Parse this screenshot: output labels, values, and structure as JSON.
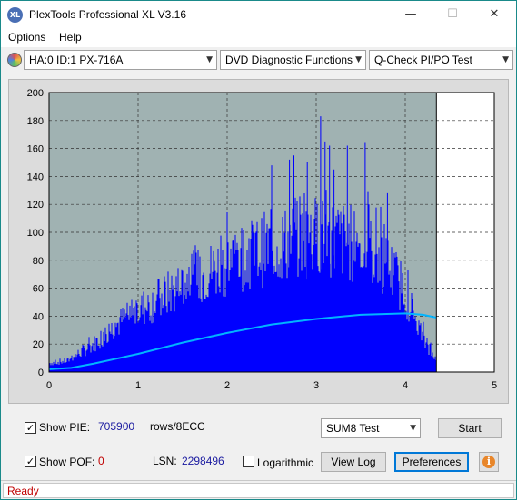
{
  "window": {
    "title": "PlexTools Professional XL V3.16",
    "logo_text": "XL",
    "minimize": "—",
    "maximize": "☐",
    "close": "✕"
  },
  "menu": {
    "options": "Options",
    "help": "Help"
  },
  "toolbar": {
    "drive": "HA:0 ID:1  PX-716A",
    "function": "DVD Diagnostic Functions",
    "test": "Q-Check PI/PO Test",
    "dropdown_arrow": "▼"
  },
  "chart_data": {
    "type": "bar",
    "x_ticks": [
      "0",
      "1",
      "2",
      "3",
      "4",
      "5"
    ],
    "y_ticks": [
      "0",
      "20",
      "40",
      "60",
      "80",
      "100",
      "120",
      "140",
      "160",
      "180",
      "200"
    ],
    "xlim": [
      0,
      5
    ],
    "ylim": [
      0,
      200
    ],
    "grid": true,
    "data_end_x": 4.35,
    "pie_envelope": {
      "x": [
        0,
        0.2,
        0.5,
        0.8,
        1.0,
        1.3,
        1.6,
        1.9,
        2.2,
        2.5,
        2.8,
        3.0,
        3.2,
        3.4,
        3.6,
        3.8,
        4.0,
        4.1,
        4.2,
        4.3,
        4.35
      ],
      "y": [
        8,
        10,
        25,
        45,
        55,
        68,
        82,
        94,
        104,
        112,
        118,
        122,
        120,
        115,
        108,
        96,
        72,
        50,
        30,
        18,
        12
      ]
    },
    "pie_spikes": {
      "x": [
        2.5,
        2.7,
        2.75,
        2.9,
        3.05,
        3.1,
        3.15,
        3.35,
        3.55,
        3.8,
        3.2
      ],
      "y": [
        148,
        152,
        155,
        150,
        183,
        165,
        162,
        162,
        164,
        128,
        145
      ]
    },
    "sum8_curve": {
      "x": [
        0,
        0.25,
        0.5,
        1.0,
        1.5,
        2.0,
        2.5,
        3.0,
        3.5,
        4.0,
        4.2,
        4.35
      ],
      "y": [
        2,
        3,
        6,
        13,
        21,
        28,
        34,
        38,
        41,
        42,
        41,
        39
      ]
    },
    "colors": {
      "bars": "#0000ff",
      "sum8": "#00b4ff",
      "plot_bg": "#a0b2b2",
      "right_bg": "#ffffff"
    }
  },
  "controls": {
    "show_pie_label": "Show PIE:",
    "show_pie_checked": "✓",
    "pie_value": "705900",
    "pie_unit": "rows/8ECC",
    "show_pof_label": "Show POF:",
    "show_pof_checked": "✓",
    "pof_value": "0",
    "lsn_label": "LSN:",
    "lsn_value": "2298496",
    "logarithmic_label": "Logarithmic",
    "test_mode": "SUM8 Test",
    "start": "Start",
    "view_log": "View Log",
    "preferences": "Preferences",
    "info_icon": "i"
  },
  "status": {
    "text": "Ready"
  }
}
